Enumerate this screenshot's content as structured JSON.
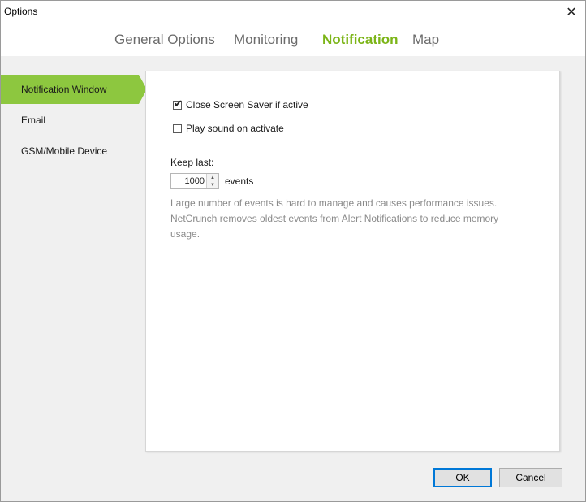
{
  "window": {
    "title": "Options",
    "close_glyph": "✕"
  },
  "tabs": [
    {
      "label": "General Options",
      "active": false
    },
    {
      "label": "Monitoring",
      "active": false
    },
    {
      "label": "Notification",
      "active": true
    },
    {
      "label": "Map",
      "active": false
    }
  ],
  "sidebar": {
    "items": [
      {
        "label": "Notification Window",
        "active": true
      },
      {
        "label": "Email",
        "active": false
      },
      {
        "label": "GSM/Mobile Device",
        "active": false
      }
    ]
  },
  "panel": {
    "close_screensaver": {
      "label": "Close Screen Saver if active",
      "checked": true
    },
    "play_sound": {
      "label": "Play sound on activate",
      "checked": false
    },
    "keep_last_label": "Keep last:",
    "keep_last_value": "1000",
    "events_label": "events",
    "hint": "Large number of events is hard to manage and causes performance issues. NetCrunch removes oldest events from Alert Notifications to reduce memory usage."
  },
  "buttons": {
    "ok": "OK",
    "cancel": "Cancel"
  },
  "colors": {
    "accent": "#7cb518",
    "sidebar_active": "#8dc73f",
    "ok_border": "#0078d7"
  },
  "icons": {
    "close": "close-icon",
    "check": "checkmark-icon",
    "spin_up": "chevron-up-icon",
    "spin_down": "chevron-down-icon"
  }
}
